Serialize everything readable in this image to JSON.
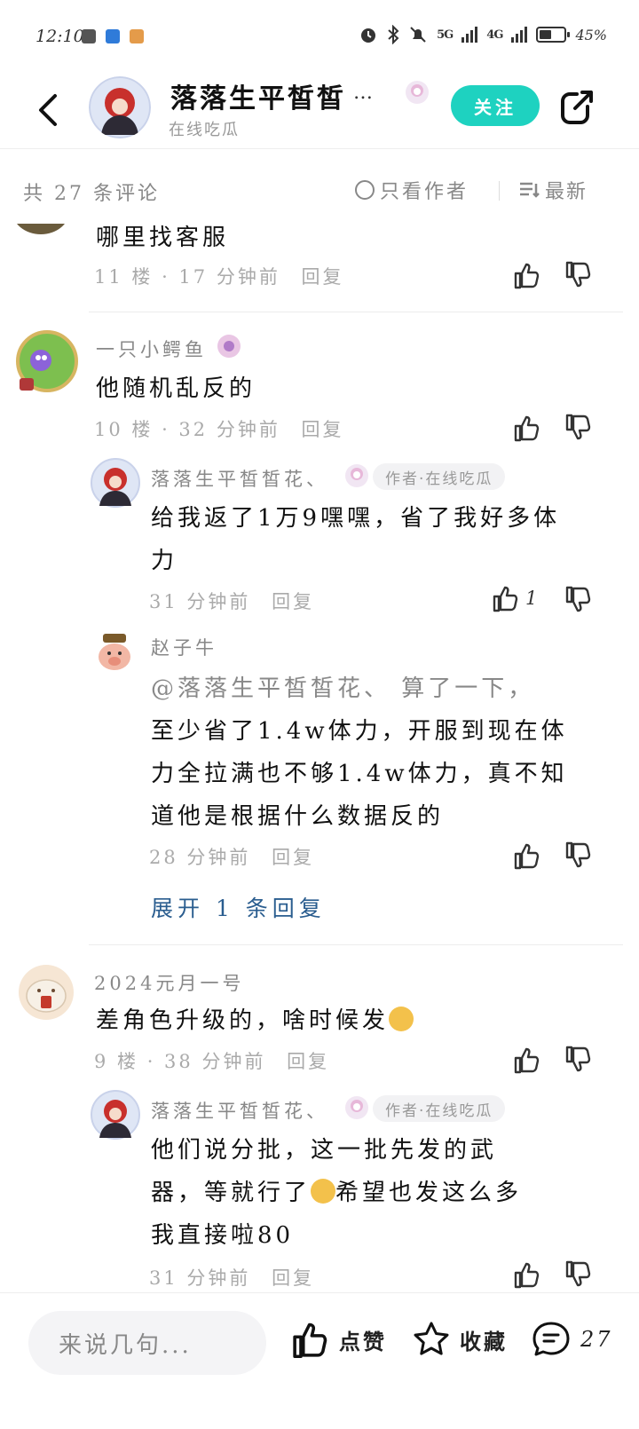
{
  "status_bar": {
    "time": "12:10",
    "battery": "45%",
    "net_5g": "5G",
    "net_4g": "4G"
  },
  "header": {
    "title": "落落生平皙皙",
    "ellipsis": "…",
    "subtitle": "在线吃瓜",
    "follow_label": "关注"
  },
  "count_bar": {
    "total": "共 27 条评论",
    "only_author": "只看作者",
    "sort": "最新"
  },
  "comments": [
    {
      "text": "哪里找客服",
      "meta": "11 楼 · 17 分钟前",
      "reply_label": "回复"
    },
    {
      "username": "一只小鳄鱼",
      "text": "他随机乱反的",
      "meta": "10 楼 · 32 分钟前",
      "reply_label": "回复",
      "replies": [
        {
          "username": "落落生平皙皙花、",
          "tag": "作者·在线吃瓜",
          "text_line1": "给我返了1万9嘿嘿，省了我好多体",
          "text_line2": "力",
          "meta": "31 分钟前",
          "reply_label": "回复",
          "likes": "1"
        },
        {
          "username": "赵子牛",
          "line1": "@落落生平皙皙花、 算了一下，",
          "line2": "至少省了1.4w体力，开服到现在体",
          "line3": "力全拉满也不够1.4w体力，真不知",
          "line4": "道他是根据什么数据反的",
          "meta": "28 分钟前",
          "reply_label": "回复"
        }
      ],
      "expand_label": "展开 1 条回复"
    },
    {
      "username": "2024元月一号",
      "text": "差角色升级的，啥时候发",
      "meta": "9 楼 · 38 分钟前",
      "reply_label": "回复",
      "replies": [
        {
          "username": "落落生平皙皙花、",
          "tag": "作者·在线吃瓜",
          "line1": "他们说分批，这一批先发的武",
          "line2a": "器，等就行了",
          "line2b": "希望也发这么多",
          "line3": "我直接啦80",
          "meta": "31 分钟前",
          "reply_label": "回复"
        }
      ]
    }
  ],
  "bottom_bar": {
    "input_placeholder": "来说几句...",
    "like_label": "点赞",
    "collect_label": "收藏",
    "comment_count": "27"
  },
  "colors": {
    "accent": "#1ed2c0",
    "link": "#2a5d8f",
    "meta": "#aaaaaa"
  }
}
